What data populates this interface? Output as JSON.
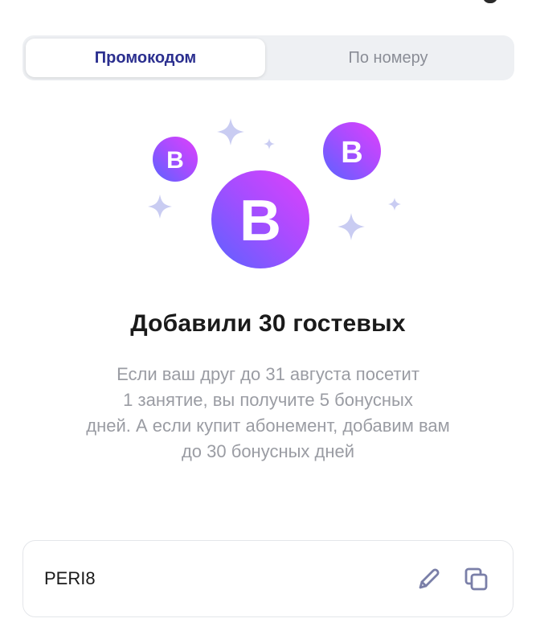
{
  "tabs": [
    {
      "label": "Промокодом",
      "active": true
    },
    {
      "label": "По номеру",
      "active": false
    }
  ],
  "illustration": {
    "badge_letter": "B",
    "gradient_colors": [
      "#6a5cff",
      "#b54bff",
      "#e040fb"
    ],
    "sparkle_color": "#c9ccf2"
  },
  "headline": "Добавили 30 гостевых",
  "description_lines": [
    "Если ваш друг до 31 августа посетит",
    "1 занятие, вы получите 5 бонусных",
    "дней. А если купит абонемент, добавим вам",
    "до 30 бонусных дней"
  ],
  "promo": {
    "code": "PERI8",
    "edit_icon": "pencil-icon",
    "copy_icon": "copy-icon"
  },
  "colors": {
    "accent_text": "#2b2f8f",
    "muted_text": "#9a9ca3",
    "icon_color": "#7a7fa8"
  }
}
